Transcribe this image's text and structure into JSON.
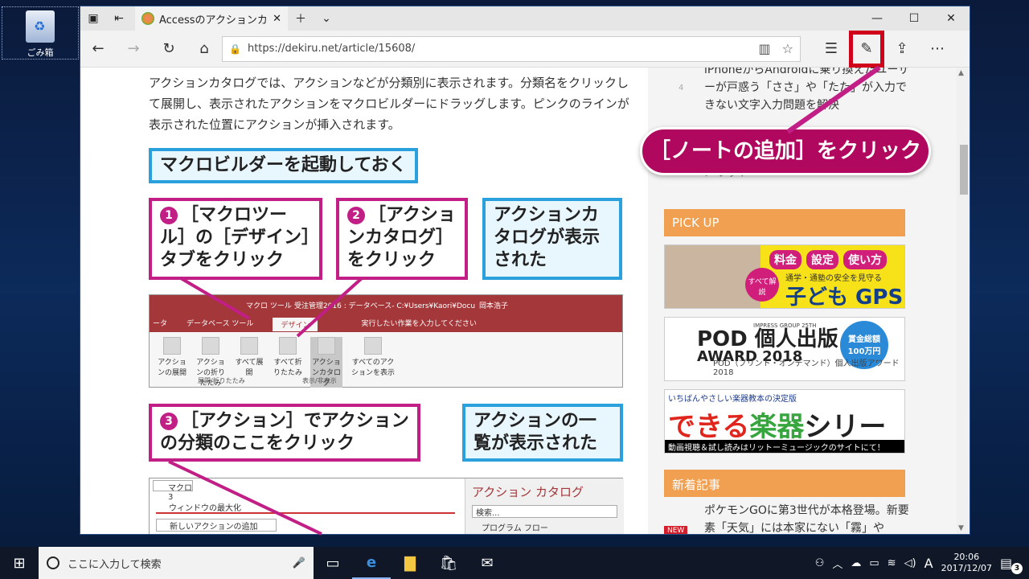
{
  "desktop": {
    "recycle_bin": "ごみ箱"
  },
  "browser": {
    "tab_title": "Accessのアクションカタログ",
    "url": "https://dekiru.net/article/15608/",
    "annotation_callout": "［ノートの追加］をクリック"
  },
  "article": {
    "paragraph": "アクションカタログでは、アクションなどが分類別に表示されます。分類名をクリックして展開し、表示されたアクションをマクロビルダーにドラッグします。ピンクのラインが表示された位置にアクションが挿入されます。",
    "heading_box": "マクロビルダーを起動しておく",
    "step1": {
      "num": "1",
      "text": "［マクロツール］の［デザイン］タブをクリック"
    },
    "step2": {
      "num": "2",
      "text": "［アクションカタログ］をクリック"
    },
    "result1": "アクションカタログが表示された",
    "step3": {
      "num": "3",
      "text": "［アクション］でアクションの分類のここをクリック"
    },
    "result2": "アクションの一覧が表示された",
    "ribbon": {
      "title": "受注管理2016 : データベース- C:¥Users¥Kaori¥Docu",
      "user": "岡本浩子",
      "tool_label": "マクロ ツール",
      "tabs": [
        "ータ",
        "データベース ツール",
        "デザイン"
      ],
      "tell_me": "実行したい作業を入力してください",
      "buttons": [
        "アクションの展開",
        "アクションの折りたたみ",
        "すべて展開",
        "すべて折りたたみ",
        "アクションカタログ",
        "すべてのアクションを表示"
      ],
      "group1": "展開/折りたたみ",
      "group2": "表示/非表示"
    },
    "macro": {
      "tab": "マクロ3",
      "row1": "ウィンドウの最大化",
      "row2": "新しいアクションの追加",
      "catalog_title": "アクション カタログ",
      "search_ph": "検索...",
      "folder": "プログラム フロー"
    }
  },
  "sidebar": {
    "top_text": "iPhoneからAndroidに乗り換えたユーザーが戸惑う「ささ」や「たた」が入力できない文字入力問題を解決",
    "rank": "4",
    "clipped_text": "メリット",
    "pickup": "PICK UP",
    "ad1": {
      "chips": [
        "料金",
        "設定",
        "使い方"
      ],
      "seal": "すべて解説",
      "sub": "通学・通塾の安全を見守る",
      "big": "子ども GPS"
    },
    "ad2": {
      "imp": "IMPRESS GROUP 25TH",
      "line1": "POD 個人出版",
      "line2": "AWARD 2018",
      "prize": "賞金総額 100万円",
      "caption": "POD（プリント・オンデマンド）個人出版アワード2018"
    },
    "ad3": {
      "top": "いちばんやさしい楽器教本の決定版",
      "logo_a": "できる",
      "logo_b": "楽器",
      "logo_c": "シリーズ",
      "bottom": "動画視聴＆試し読みはリットーミュージックのサイトにて！"
    },
    "news_header": "新着記事",
    "news_badge": "NEW",
    "news_text": "ポケモンGOに第3世代が本格登場。新要素「天気」には本家にない「霧」や"
  },
  "taskbar": {
    "search_placeholder": "ここに入力して検索",
    "time": "20:06",
    "date": "2017/12/07",
    "ime": "A",
    "notifications": "3"
  }
}
